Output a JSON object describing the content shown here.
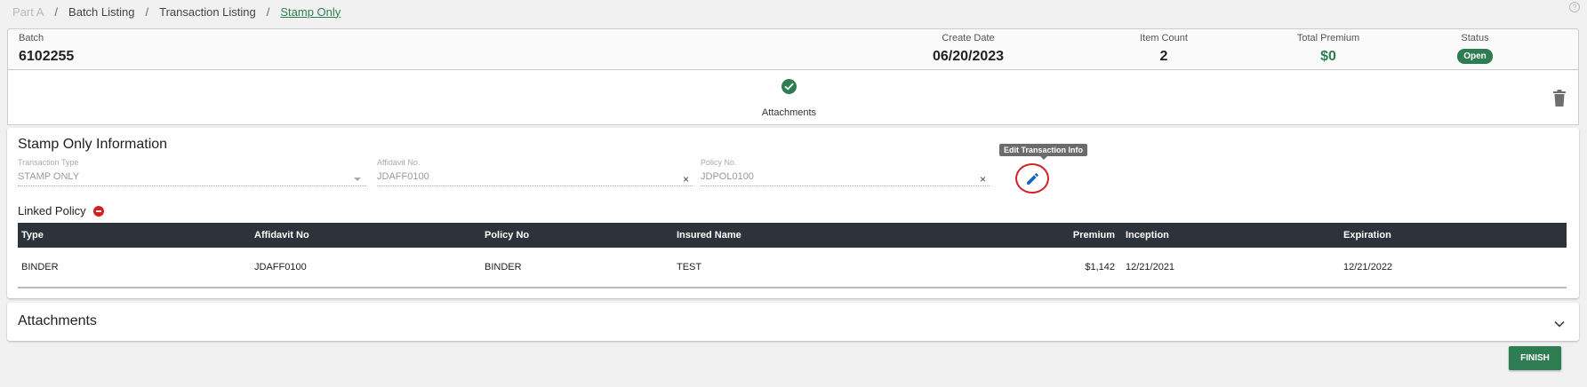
{
  "breadcrumb": {
    "items": [
      "Part A",
      "Batch Listing",
      "Transaction Listing",
      "Stamp Only"
    ],
    "separator": "/"
  },
  "help_icon": "?",
  "batch": {
    "batch_label": "Batch",
    "batch_value": "6102255",
    "create_date_label": "Create Date",
    "create_date_value": "06/20/2023",
    "item_count_label": "Item Count",
    "item_count_value": "2",
    "total_premium_label": "Total Premium",
    "total_premium_value": "$0",
    "status_label": "Status",
    "status_value": "Open"
  },
  "attachments_strip": {
    "label": "Attachments",
    "icon": "check-circle-icon",
    "delete_icon": "trash-icon"
  },
  "stamp_info": {
    "title": "Stamp Only Information",
    "fields": {
      "transaction_type": {
        "label": "Transaction Type",
        "value": "STAMP ONLY"
      },
      "affidavit_no": {
        "label": "Affidavit No.",
        "value": "JDAFF0100"
      },
      "policy_no": {
        "label": "Policy No.",
        "value": "JDPOL0100"
      }
    },
    "clear_glyph": "×",
    "edit_tooltip": "Edit Transaction Info",
    "edit_icon": "pencil-icon"
  },
  "linked_policy": {
    "label": "Linked Policy",
    "remove_icon": "remove-circle-icon",
    "columns": [
      "Type",
      "Affidavit No",
      "Policy No",
      "Insured Name",
      "Premium",
      "Inception",
      "Expiration"
    ],
    "rows": [
      [
        "BINDER",
        "JDAFF0100",
        "BINDER",
        "TEST",
        "$1,142",
        "12/21/2021",
        "12/21/2022"
      ]
    ]
  },
  "attachments_section": {
    "title": "Attachments",
    "icon": "chevron-down-icon"
  },
  "finish_button": "FINISH",
  "colors": {
    "accent_green": "#2e7d52",
    "table_header": "#2c333b",
    "highlight_red": "#d32020",
    "edit_blue": "#1565c0"
  }
}
